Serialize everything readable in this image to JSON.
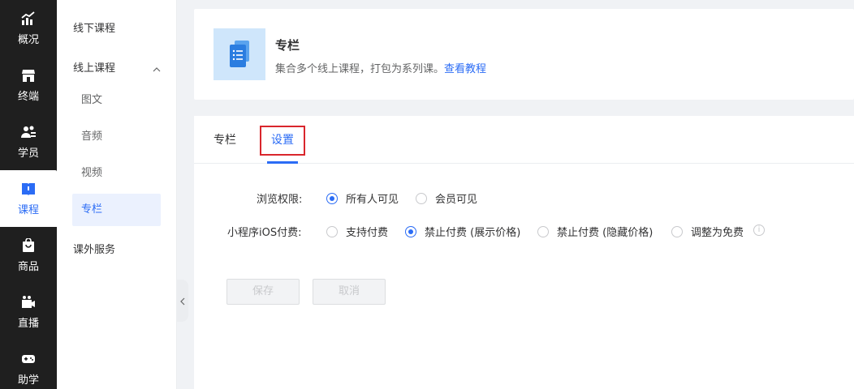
{
  "rail": {
    "items": [
      {
        "label": "概况",
        "icon": "chart-trend-icon"
      },
      {
        "label": "终端",
        "icon": "storefront-icon"
      },
      {
        "label": "学员",
        "icon": "users-icon"
      },
      {
        "label": "课程",
        "icon": "book-icon",
        "active": true
      },
      {
        "label": "商品",
        "icon": "shopping-bag-icon"
      },
      {
        "label": "直播",
        "icon": "video-camera-icon"
      },
      {
        "label": "助学",
        "icon": "gamepad-icon"
      }
    ]
  },
  "subnav": {
    "offline": "线下课程",
    "online": "线上课程",
    "children": [
      "图文",
      "音频",
      "视频",
      "专栏"
    ],
    "extra": "课外服务"
  },
  "header": {
    "title": "专栏",
    "desc": "集合多个线上课程，打包为系列课。",
    "link": "查看教程"
  },
  "tabs": [
    "专栏",
    "设置"
  ],
  "form": {
    "browse_label": "浏览权限:",
    "browse_options": [
      "所有人可见",
      "会员可见"
    ],
    "browse_selected": 0,
    "ios_label": "小程序iOS付费:",
    "ios_options": [
      "支持付费",
      "禁止付费 (展示价格)",
      "禁止付费 (隐藏价格)",
      "调整为免费"
    ],
    "ios_selected": 1,
    "info_glyph": "i"
  },
  "buttons": {
    "save": "保存",
    "cancel": "取消"
  },
  "colors": {
    "accent": "#2b6cf5",
    "rail_bg": "#1f1f1f",
    "highlight": "#d9262c",
    "icon_tile": "#cfe6fb"
  }
}
